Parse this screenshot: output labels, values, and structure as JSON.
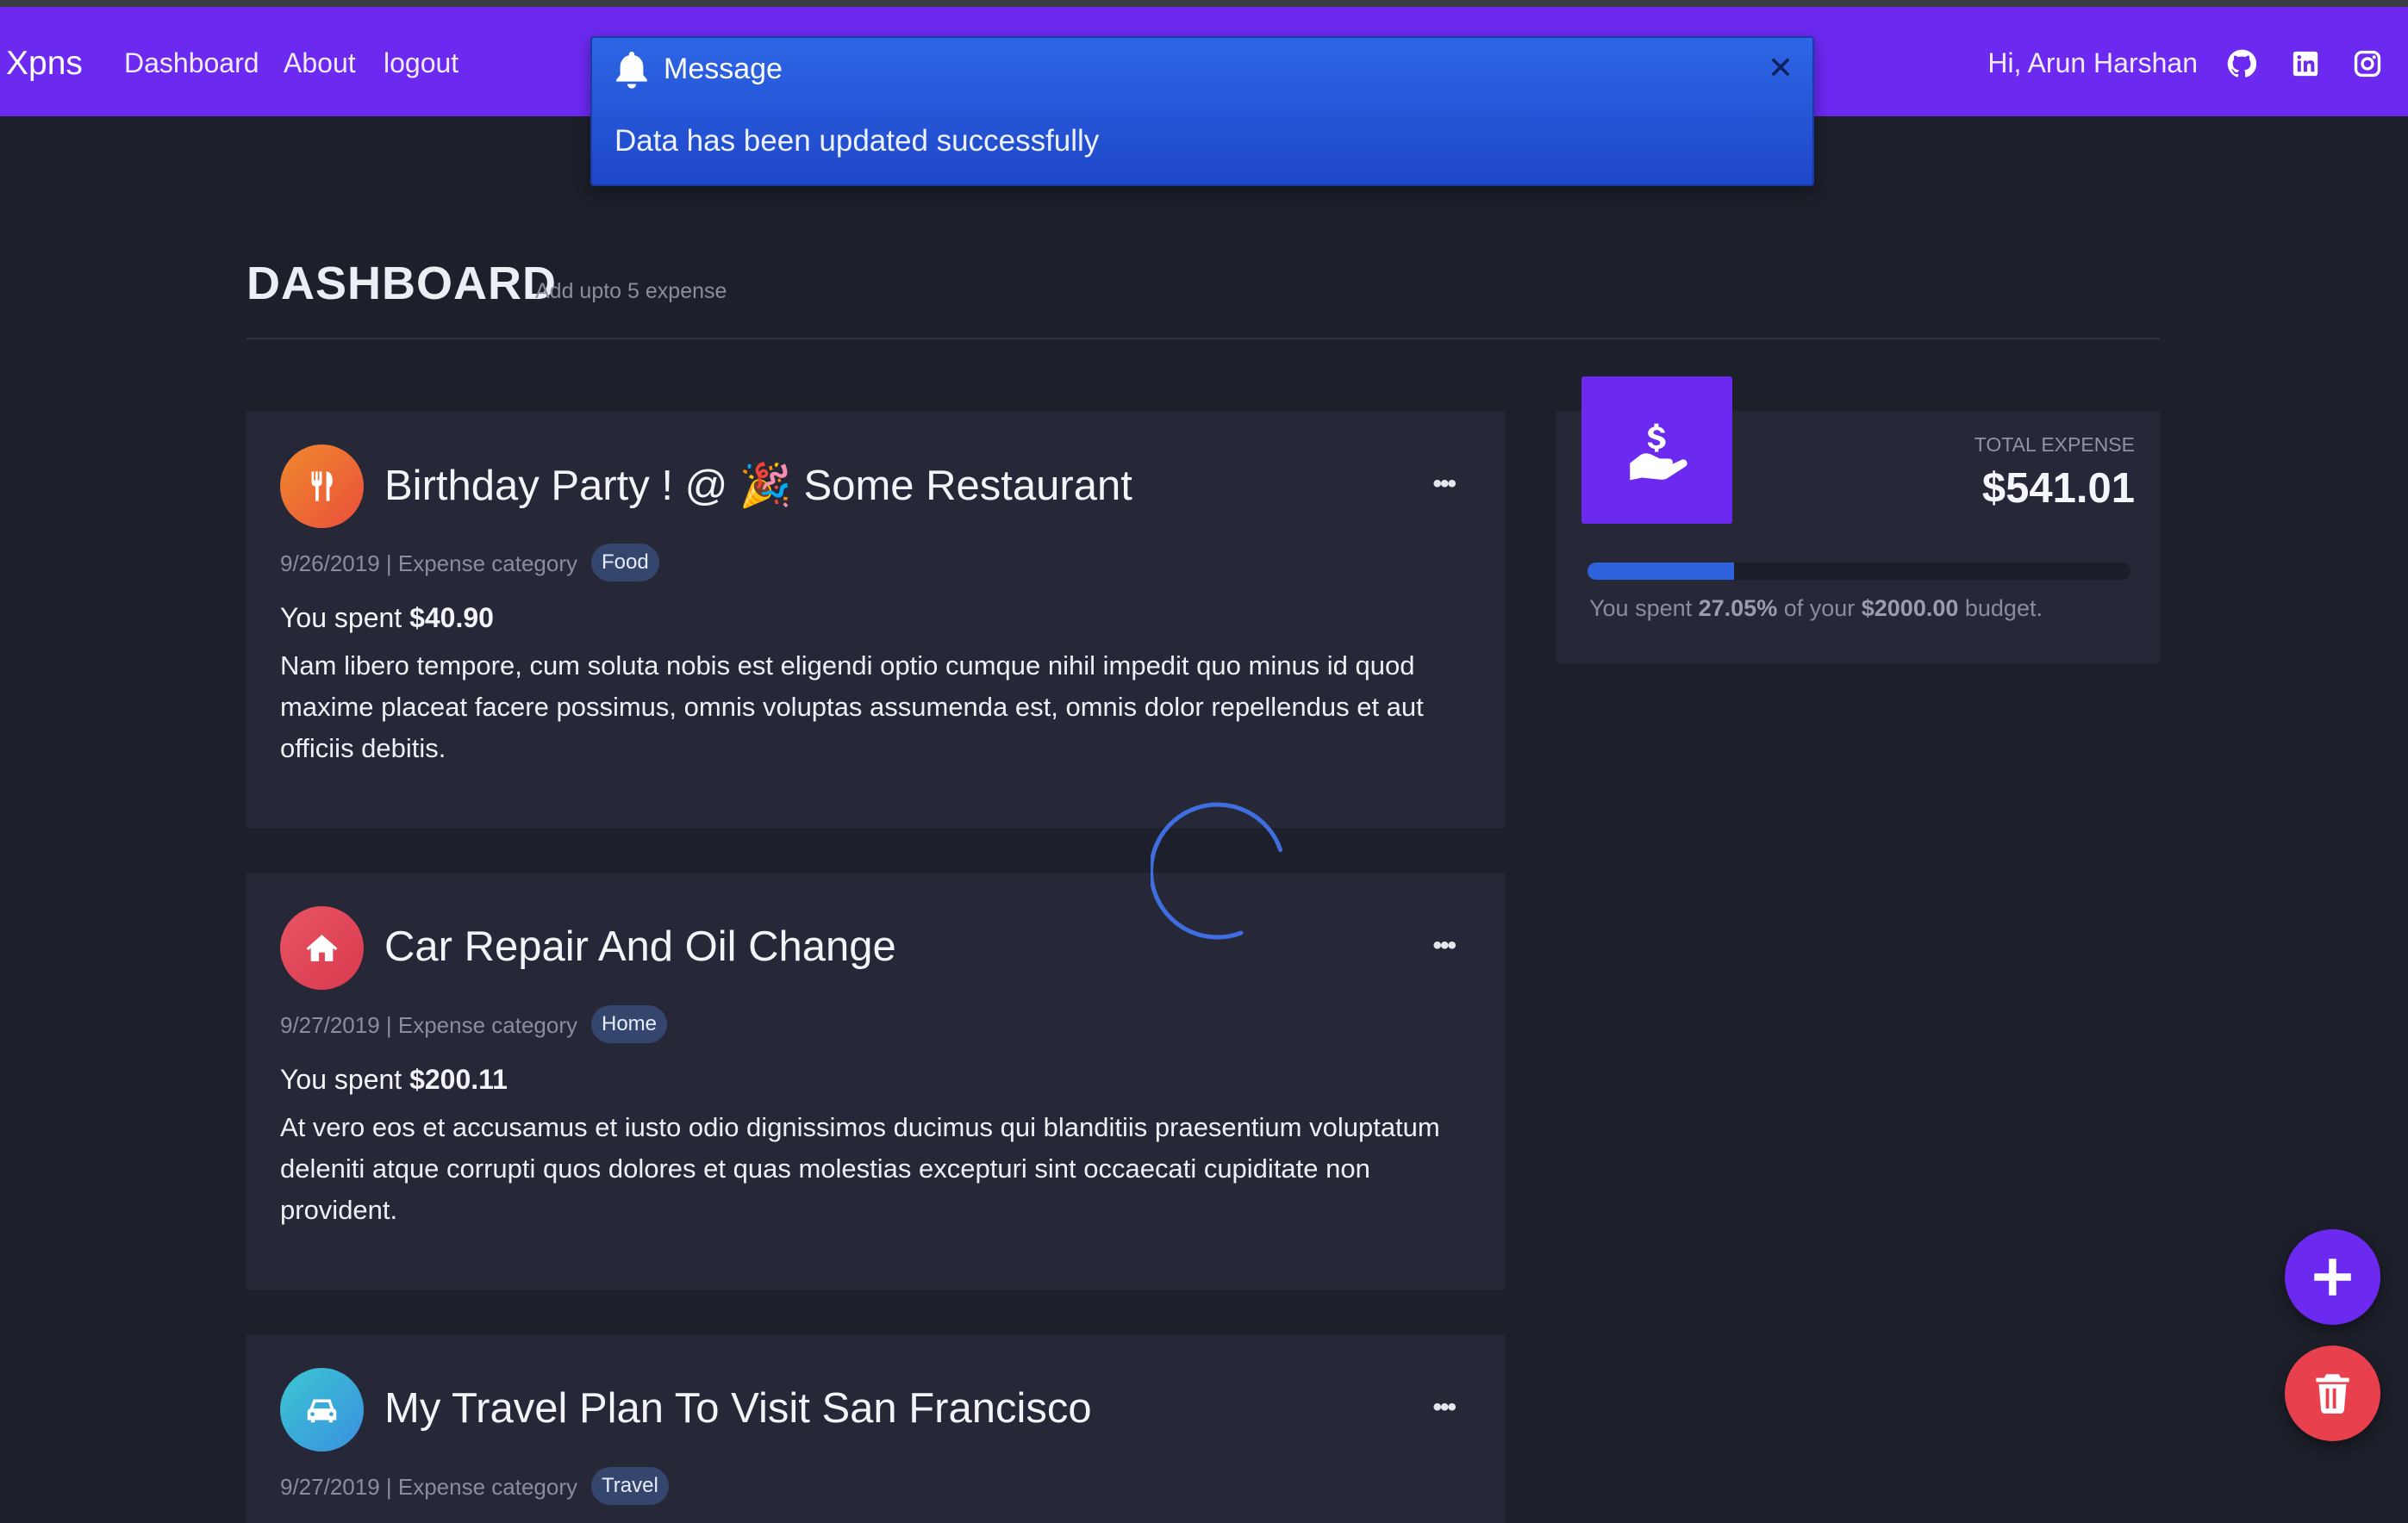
{
  "nav": {
    "brand": "Xpns",
    "links": [
      "Dashboard",
      "About",
      "logout"
    ],
    "greeting": "Hi, Arun Harshan",
    "icons": [
      "github-icon",
      "linkedin-icon",
      "instagram-icon"
    ]
  },
  "toast": {
    "title": "Message",
    "body": "Data has been updated successfully",
    "close": "✕"
  },
  "page": {
    "title": "DASHBOARD",
    "subtitle": "Add upto 5 expense"
  },
  "expenses": [
    {
      "title": "Birthday Party ! @ 🎉 Some Restaurant",
      "date": "9/26/2019",
      "meta_label": " | Expense category",
      "category": "Food",
      "icon": "food-icon",
      "spent_label": "You spent ",
      "amount": "$40.90",
      "description": "Nam libero tempore, cum soluta nobis est eligendi optio cumque nihil impedit quo minus id quod maxime placeat facere possimus, omnis voluptas assumenda est, omnis dolor repellendus et aut officiis debitis.",
      "more": "•••"
    },
    {
      "title": "Car Repair And Oil Change",
      "date": "9/27/2019",
      "meta_label": " | Expense category",
      "category": "Home",
      "icon": "home-icon",
      "spent_label": "You spent ",
      "amount": "$200.11",
      "description": "At vero eos et accusamus et iusto odio dignissimos ducimus qui blanditiis praesentium voluptatum deleniti atque corrupti quos dolores et quas molestias excepturi sint occaecati cupiditate non provident.",
      "more": "•••"
    },
    {
      "title": "My Travel Plan To Visit San Francisco",
      "date": "9/27/2019",
      "meta_label": " | Expense category",
      "category": "Travel",
      "icon": "car-icon",
      "more": "•••"
    }
  ],
  "total": {
    "label": "TOTAL EXPENSE",
    "value": "$541.01",
    "note_prefix": "You spent ",
    "percent": "27.05%",
    "note_mid": " of your ",
    "budget": "$2000.00",
    "note_suffix": " budget.",
    "progress_fraction": 0.2705
  },
  "colors": {
    "nav": "#6c29f0",
    "toast": "#2458d8",
    "food": "#f26a2b",
    "home": "#e2495a",
    "travel": "#38b6d9",
    "fab_add": "#6c29f0",
    "fab_delete": "#e8414d"
  }
}
